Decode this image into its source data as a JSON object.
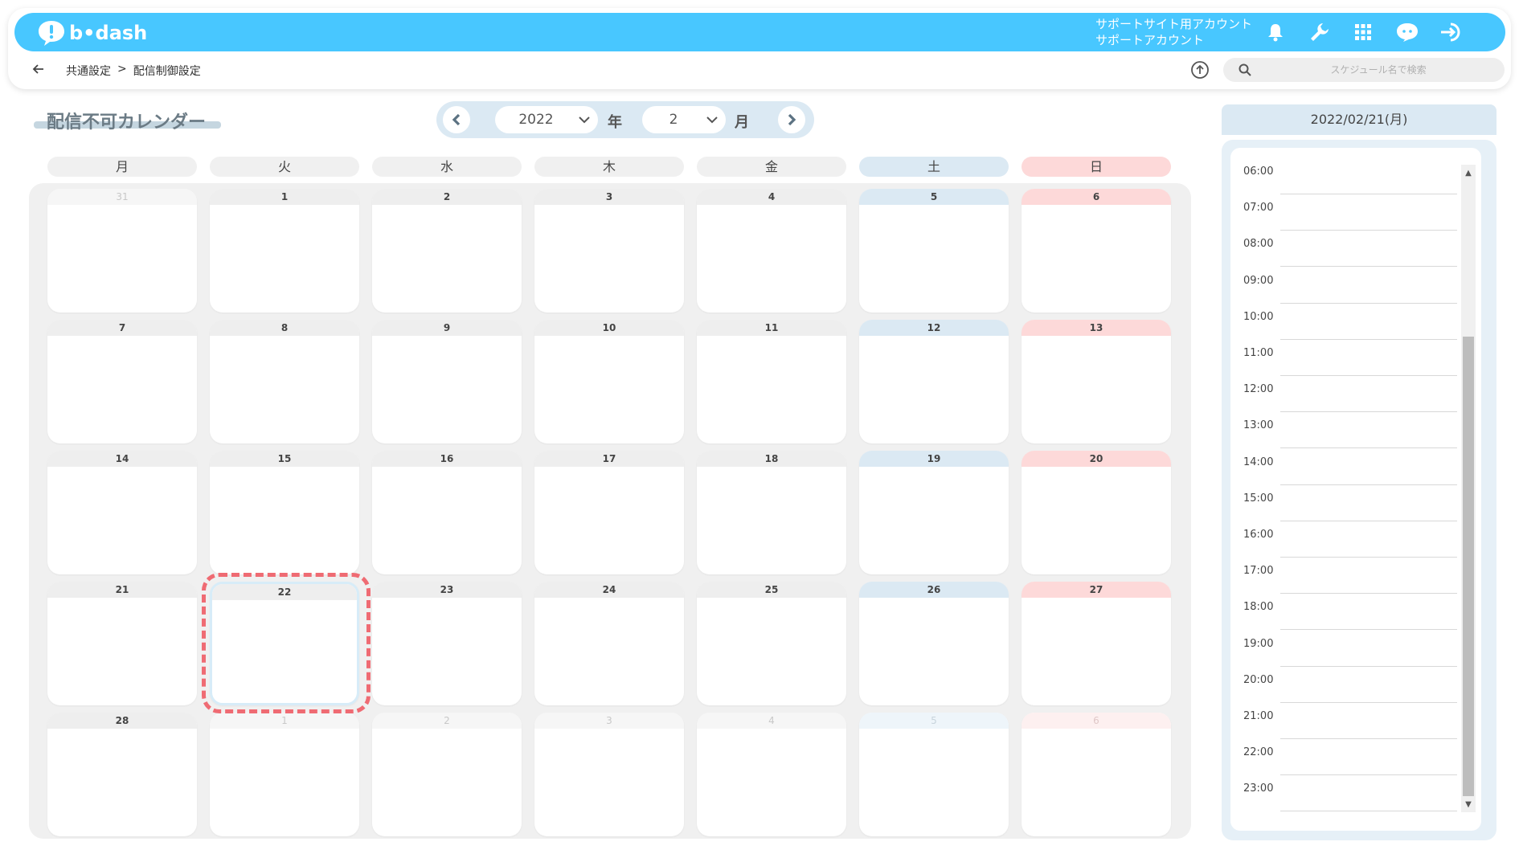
{
  "header": {
    "logo_text": "b•dash",
    "account_line1": "サポートサイト用アカウント",
    "account_line2": "サポートアカウント",
    "icons": [
      "bell-icon",
      "wrench-icon",
      "grid-icon",
      "chat-bubble-icon",
      "logout-icon"
    ]
  },
  "subbar": {
    "breadcrumb": [
      "共通設定",
      "配信制御設定"
    ],
    "breadcrumb_sep": ">",
    "search_placeholder": "スケジュール名で検索"
  },
  "page": {
    "title": "配信不可カレンダー"
  },
  "month_nav": {
    "year": "2022",
    "year_unit": "年",
    "month": "2",
    "month_unit": "月"
  },
  "weekdays": [
    "月",
    "火",
    "水",
    "木",
    "金",
    "土",
    "日"
  ],
  "calendar": {
    "weeks": [
      [
        {
          "d": "31",
          "o": true
        },
        {
          "d": "1"
        },
        {
          "d": "2"
        },
        {
          "d": "3"
        },
        {
          "d": "4"
        },
        {
          "d": "5"
        },
        {
          "d": "6"
        }
      ],
      [
        {
          "d": "7"
        },
        {
          "d": "8"
        },
        {
          "d": "9"
        },
        {
          "d": "10"
        },
        {
          "d": "11"
        },
        {
          "d": "12"
        },
        {
          "d": "13"
        }
      ],
      [
        {
          "d": "14"
        },
        {
          "d": "15"
        },
        {
          "d": "16"
        },
        {
          "d": "17"
        },
        {
          "d": "18"
        },
        {
          "d": "19"
        },
        {
          "d": "20"
        }
      ],
      [
        {
          "d": "21"
        },
        {
          "d": "22",
          "s": true
        },
        {
          "d": "23"
        },
        {
          "d": "24"
        },
        {
          "d": "25"
        },
        {
          "d": "26"
        },
        {
          "d": "27"
        }
      ],
      [
        {
          "d": "28"
        },
        {
          "d": "1",
          "o": true
        },
        {
          "d": "2",
          "o": true
        },
        {
          "d": "3",
          "o": true
        },
        {
          "d": "4",
          "o": true
        },
        {
          "d": "5",
          "o": true
        },
        {
          "d": "6",
          "o": true
        }
      ]
    ]
  },
  "schedule": {
    "date": "2022/02/21(月)",
    "times": [
      "06:00",
      "07:00",
      "08:00",
      "09:00",
      "10:00",
      "11:00",
      "12:00",
      "13:00",
      "14:00",
      "15:00",
      "16:00",
      "17:00",
      "18:00",
      "19:00",
      "20:00",
      "21:00",
      "22:00",
      "23:00"
    ],
    "scroll_up": "▲",
    "scroll_down": "▼"
  },
  "colors": {
    "header": "#48c7ff",
    "saturday": "#dbe9f3",
    "sunday": "#fdd9d9",
    "highlight": "#ef6b73"
  }
}
